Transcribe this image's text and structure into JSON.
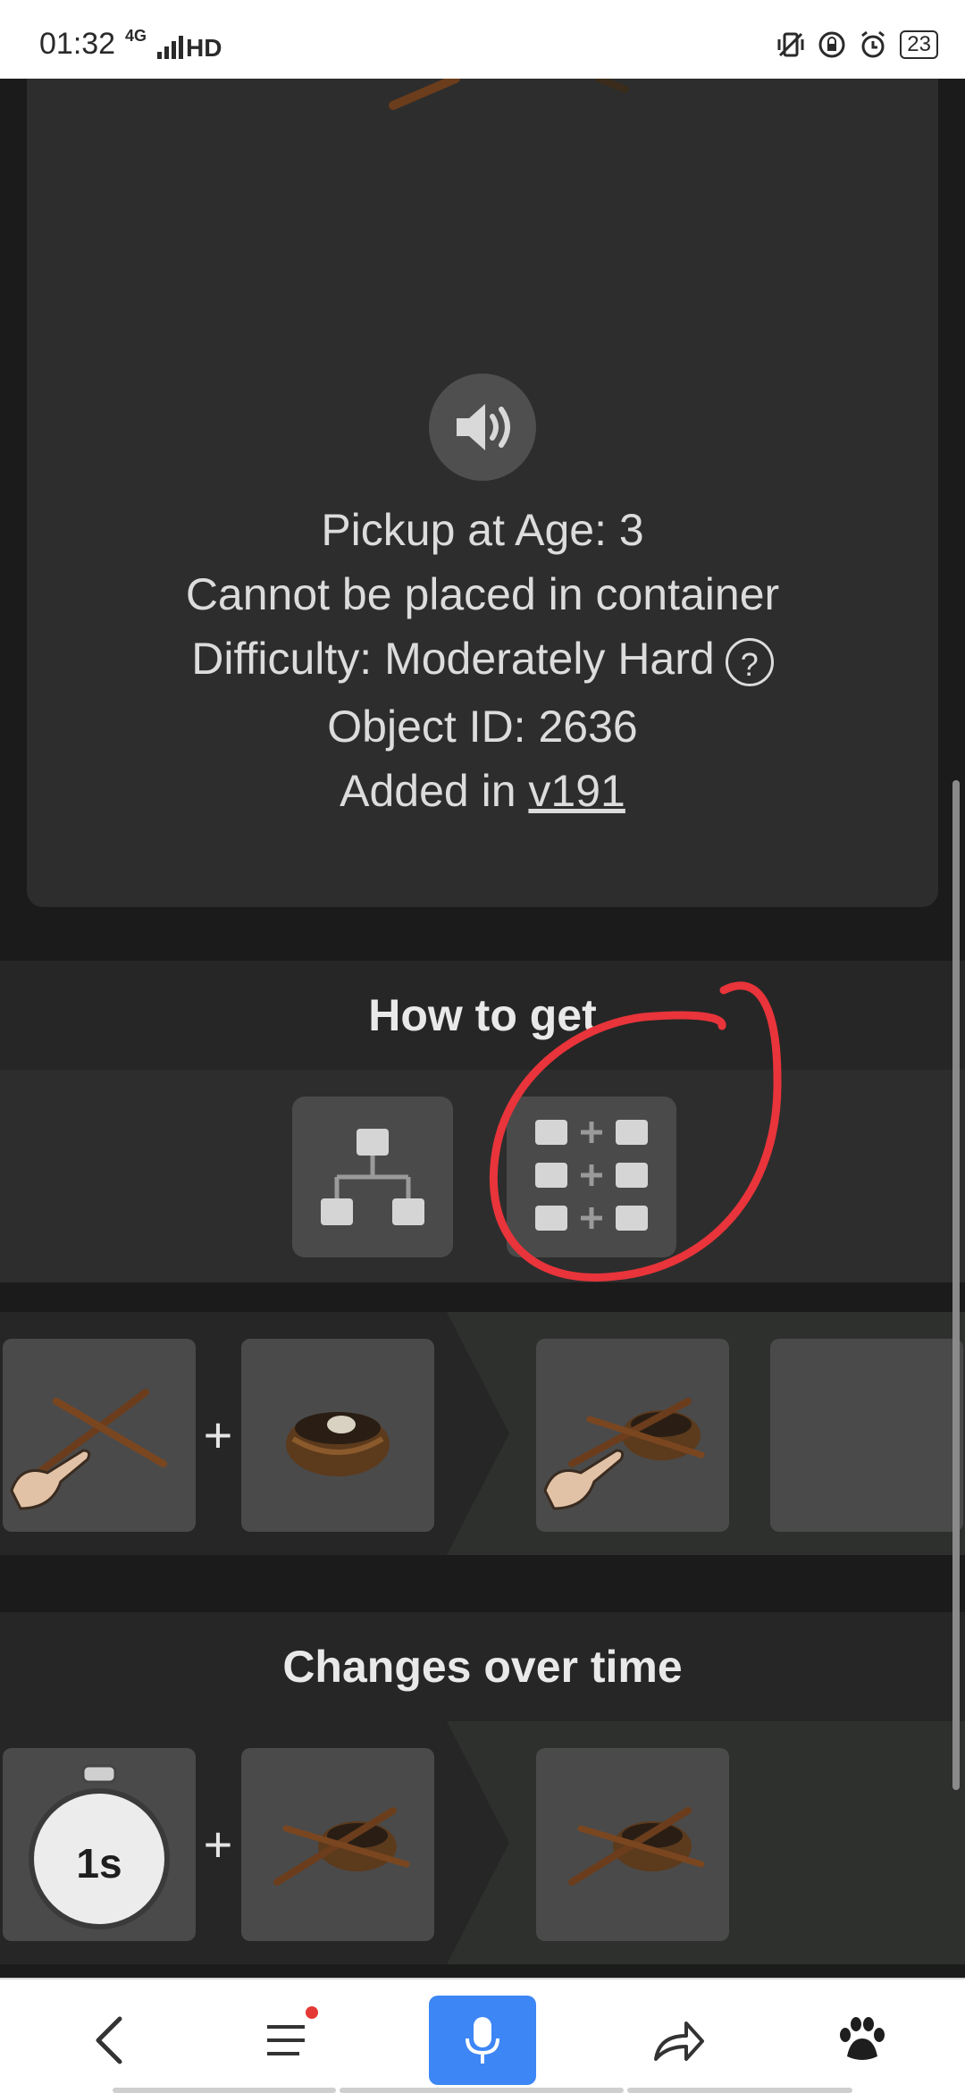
{
  "status_bar": {
    "time": "01:32",
    "network": "4G",
    "hd": "HD",
    "battery": "23"
  },
  "object_info": {
    "pickup_label": "Pickup at Age: 3",
    "container_label": "Cannot be placed in container",
    "difficulty_label": "Difficulty: Moderately Hard",
    "help_symbol": "?",
    "object_id_label": "Object ID: 2636",
    "added_prefix": "Added in ",
    "added_version": "v191"
  },
  "how_to_get": {
    "title": "How to get",
    "modes": [
      "tree-view-icon",
      "recipe-grid-icon"
    ],
    "recipe": {
      "inputs": [
        "hand-holding-sticks",
        "nest-basket"
      ],
      "plus": "+",
      "outputs": [
        "hand-holding-sticks-on-nest",
        "empty"
      ]
    }
  },
  "changes_over_time": {
    "title": "Changes over time",
    "timer_label": "1s",
    "plus": "+",
    "inputs": [
      "timer-1s",
      "sticks-on-nest"
    ],
    "outputs": [
      "sticks-on-nest"
    ]
  },
  "colors": {
    "accent": "#3d86f5",
    "annotation": "#e8343a",
    "panel": "#2d2d2d",
    "tile": "#4a4a4a"
  }
}
